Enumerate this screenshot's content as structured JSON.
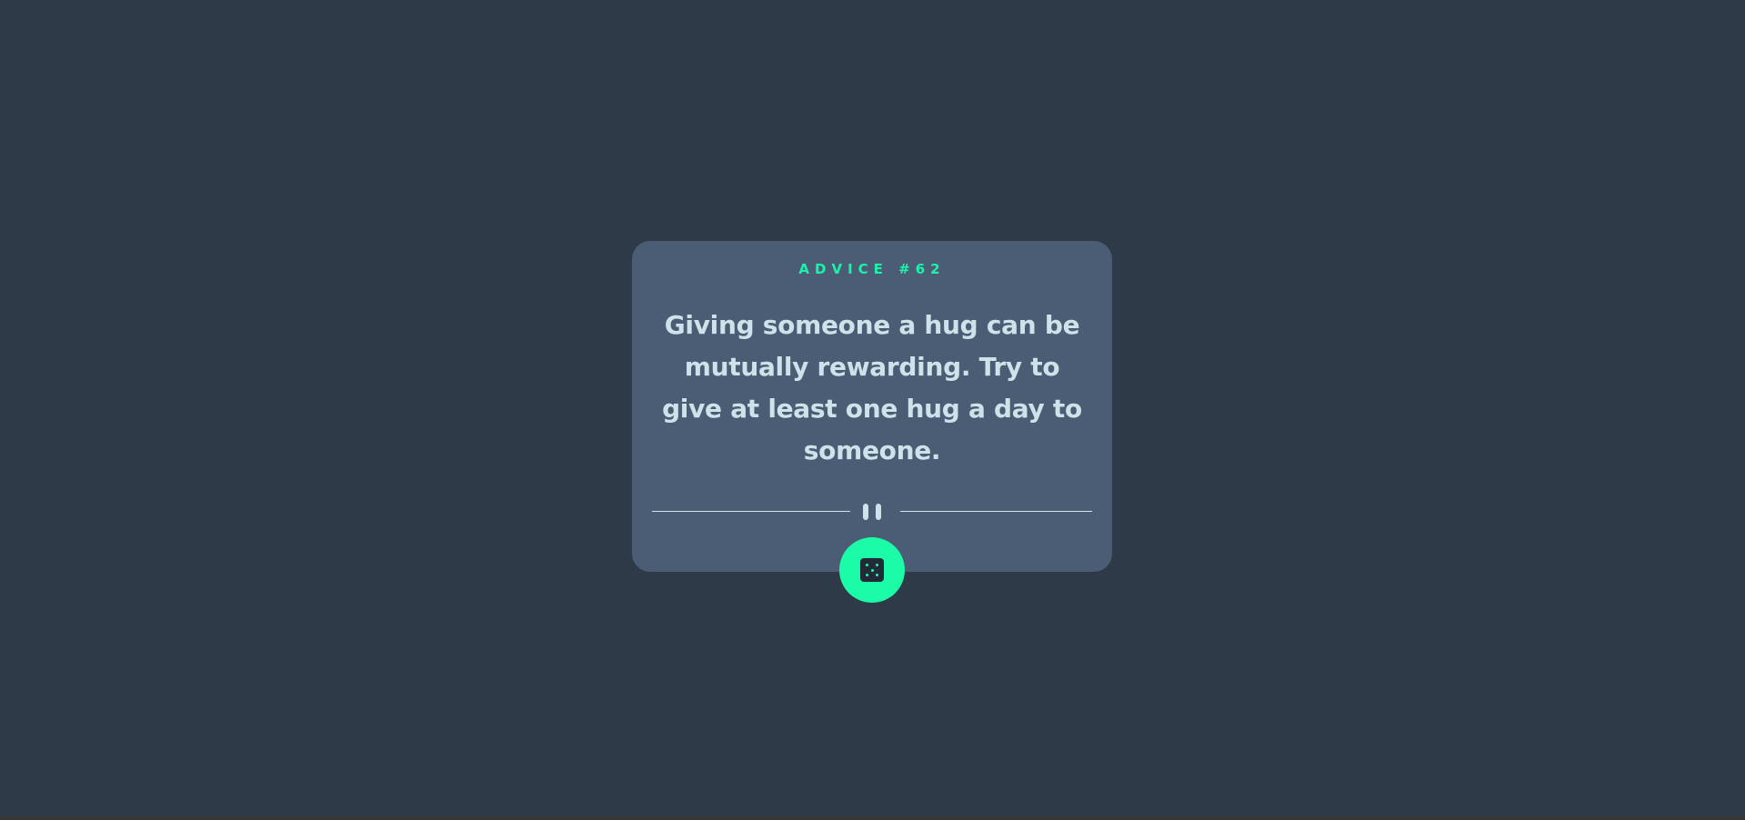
{
  "card": {
    "label": "ADVICE #62",
    "advice": "Giving someone a hug can be mutually rewarding. Try to give at least one hug a day to someone."
  },
  "icons": {
    "divider": "pause-icon",
    "button": "dice-icon"
  },
  "colors": {
    "background": "#2f3a49",
    "card": "#4a5d75",
    "accent": "#1cf3a8",
    "text": "#cde3ea"
  }
}
